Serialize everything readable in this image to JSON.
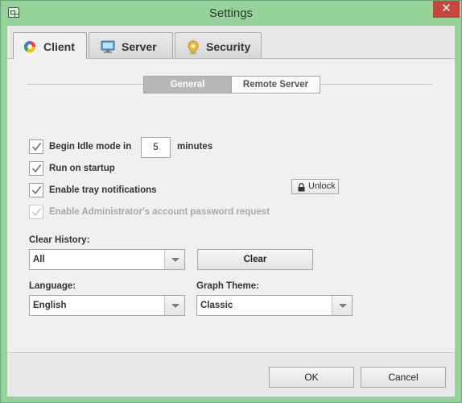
{
  "window": {
    "title": "Settings",
    "close_glyph": "✕"
  },
  "tabs": [
    {
      "label": "Client",
      "icon": "client-icon",
      "active": true
    },
    {
      "label": "Server",
      "icon": "monitor-icon",
      "active": false
    },
    {
      "label": "Security",
      "icon": "location-pin-icon",
      "active": false
    }
  ],
  "subtabs": {
    "general": "General",
    "remote_server": "Remote Server"
  },
  "options": {
    "idle_prefix": "Begin Idle mode in",
    "idle_minutes": "5",
    "idle_suffix": "minutes",
    "run_on_startup": "Run on startup",
    "tray_notifications": "Enable tray notifications",
    "admin_password": "Enable Administrator's account password request",
    "unlock_label": "Unlock"
  },
  "history": {
    "label": "Clear History:",
    "selected": "All",
    "clear_button": "Clear"
  },
  "language": {
    "label": "Language:",
    "selected": "English"
  },
  "graph_theme": {
    "label": "Graph Theme:",
    "selected": "Classic"
  },
  "footer": {
    "ok": "OK",
    "cancel": "Cancel"
  },
  "colors": {
    "window_frame": "#95d39a",
    "close_button": "#c7463b",
    "panel": "#f0f0f0"
  }
}
